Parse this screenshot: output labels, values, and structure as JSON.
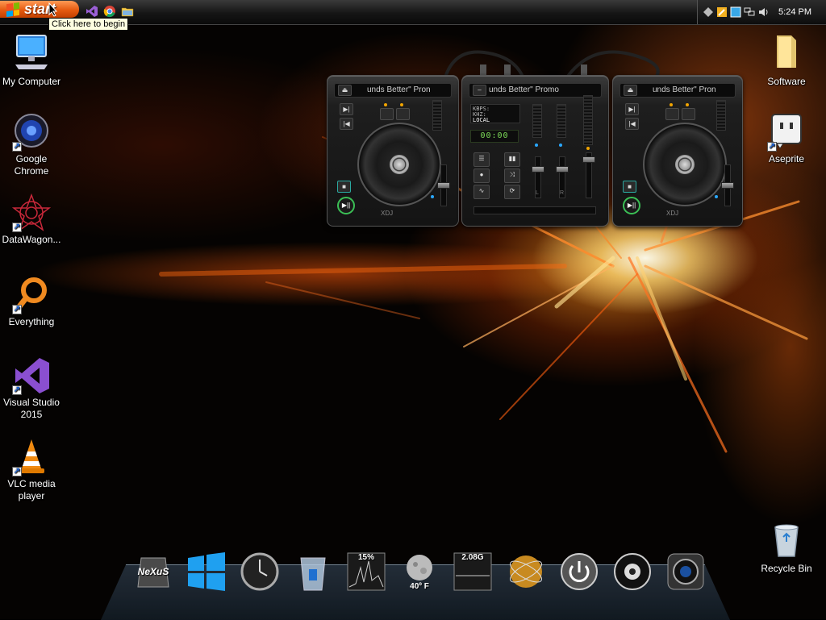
{
  "taskbar": {
    "start_label": "start",
    "tooltip": "Click here to begin",
    "quicklaunch": [
      "visual-studio-icon",
      "chrome-icon",
      "folder-icon"
    ],
    "tray_icons": [
      "diamond-icon",
      "pencil-icon",
      "blue-square-icon",
      "network-icon",
      "speaker-icon"
    ],
    "clock": "5:24 PM"
  },
  "desktop_icons": [
    {
      "label": "My Computer",
      "icon": "computer-icon"
    },
    {
      "label": "Google Chrome",
      "icon": "chrome-orb-icon"
    },
    {
      "label": "DataWagon...",
      "icon": "datawagon-icon"
    },
    {
      "label": "Everything",
      "icon": "everything-icon"
    },
    {
      "label": "Visual Studio 2015",
      "icon": "visual-studio-icon"
    },
    {
      "label": "VLC media player",
      "icon": "vlc-icon"
    },
    {
      "label": "Software",
      "icon": "folder-icon"
    },
    {
      "label": "Aseprite",
      "icon": "aseprite-icon"
    },
    {
      "label": "Recycle Bin",
      "icon": "recycle-bin-icon"
    }
  ],
  "dj_widget": {
    "left_deck_title": "unds Better\" Pron",
    "mixer_title": "unds Better\" Promo",
    "right_deck_title": "unds Better\" Pron",
    "mixer_kbps": "KBPS:",
    "mixer_khz": "KHZ:",
    "mixer_source": "LOCAL",
    "mixer_time": "00:00",
    "channel_left": "L",
    "channel_right": "R",
    "deck_brand": "XDJ"
  },
  "dock": {
    "items": [
      {
        "name": "nexus-icon",
        "label": "NeXuS"
      },
      {
        "name": "windows-icon",
        "label": ""
      },
      {
        "name": "clock-gadget-icon",
        "label": ""
      },
      {
        "name": "recycle-bin-dock-icon",
        "label": ""
      },
      {
        "name": "cpu-meter-icon",
        "label": "15%"
      },
      {
        "name": "weather-icon",
        "label": "40º F"
      },
      {
        "name": "ram-meter-icon",
        "label": "2.08G"
      },
      {
        "name": "network-globe-icon",
        "label": ""
      },
      {
        "name": "power-icon",
        "label": ""
      },
      {
        "name": "speaker-dock-icon",
        "label": ""
      },
      {
        "name": "camera-icon",
        "label": ""
      }
    ]
  },
  "colors": {
    "start": "#e55a10",
    "accent_green": "#3bbf55",
    "fire": "#ff7a1a"
  }
}
